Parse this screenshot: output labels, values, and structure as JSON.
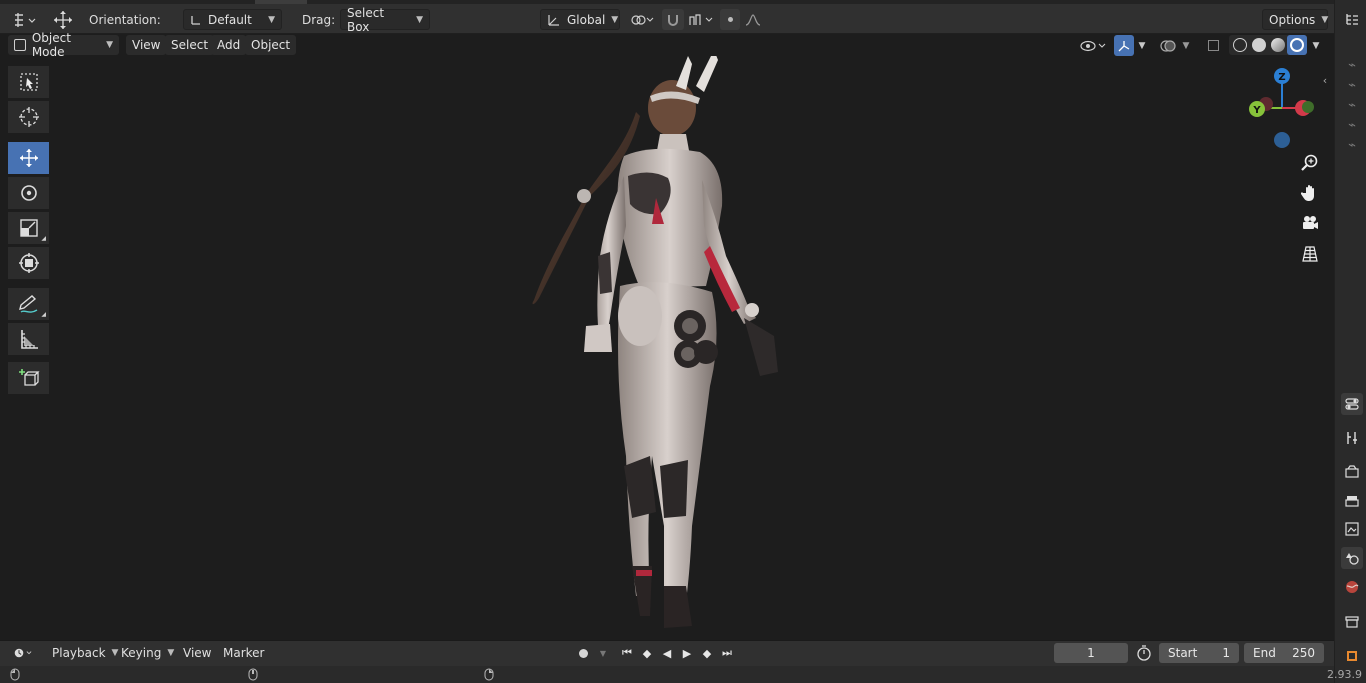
{
  "tool_settings": {
    "orientation_label": "Orientation:",
    "orientation_value": "Default",
    "drag_label": "Drag:",
    "drag_value": "Select Box",
    "transform_orientation": "Global",
    "options_label": "Options"
  },
  "header": {
    "mode": "Object Mode",
    "menus": [
      "View",
      "Select",
      "Add",
      "Object"
    ]
  },
  "gizmo": {
    "z_label": "Z",
    "y_label": "Y",
    "z_color": "#2b7fd4",
    "y_color": "#87c23a",
    "x_color": "#d23a4a"
  },
  "toolbar": {
    "tools": [
      "select-box",
      "cursor",
      "move",
      "rotate",
      "scale",
      "transform",
      "annotate",
      "measure",
      "add-cube"
    ],
    "active_tool": "move",
    "accent": "#4772b3"
  },
  "timeline": {
    "menus": [
      "Playback",
      "Keying",
      "View",
      "Marker"
    ],
    "current_frame": "1",
    "start_label": "Start",
    "start_value": "1",
    "end_label": "End",
    "end_value": "250"
  },
  "status": {
    "version": "2.93.9"
  }
}
